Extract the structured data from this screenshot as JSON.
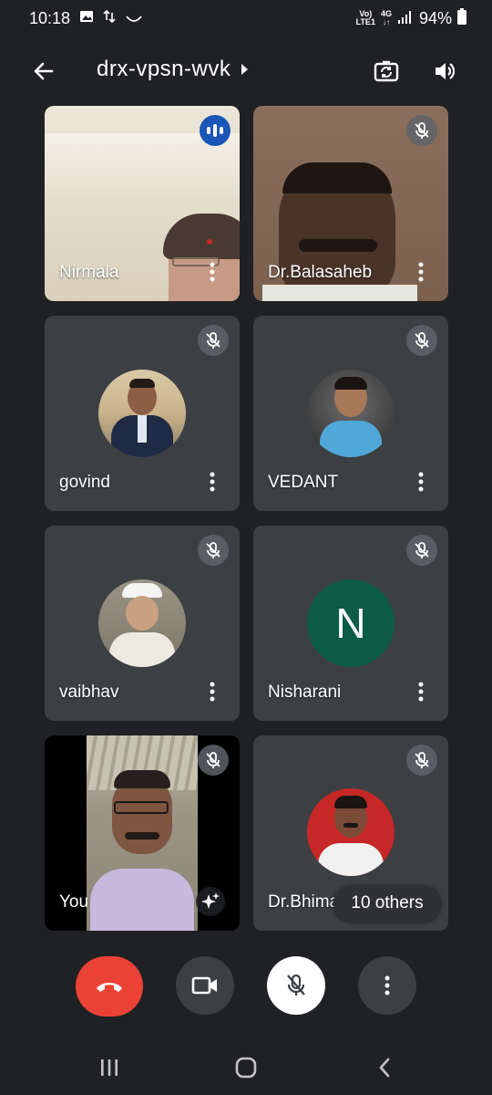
{
  "status_bar": {
    "time": "10:18",
    "network_top": "Vo)",
    "network_bottom": "LTE1",
    "net_type": "4G",
    "battery": "94%"
  },
  "header": {
    "meeting_code": "drx-vpsn-wvk",
    "icons": [
      "back-arrow-icon",
      "chevron-right-icon",
      "switch-camera-icon",
      "speaker-icon"
    ]
  },
  "participants": [
    {
      "name": "Nirmala",
      "state": "speaking",
      "media": "video"
    },
    {
      "name": "Dr.Balasaheb",
      "state": "muted",
      "media": "video"
    },
    {
      "name": "govind",
      "state": "muted",
      "media": "avatar-photo"
    },
    {
      "name": "VEDANT",
      "state": "muted",
      "media": "avatar-photo"
    },
    {
      "name": "vaibhav",
      "state": "muted",
      "media": "avatar-photo"
    },
    {
      "name": "Nisharani",
      "state": "muted",
      "media": "avatar-letter",
      "initial": "N",
      "avatar_color": "#0d5c46"
    },
    {
      "name": "You",
      "state": "muted",
      "media": "video"
    },
    {
      "name": "Dr.Bhima",
      "state": "muted",
      "media": "avatar-photo"
    }
  ],
  "others_label": "10 others",
  "controls": {
    "end_call_color": "#ea4335",
    "icons": [
      "hang-up-icon",
      "video-camera-icon",
      "mic-off-icon",
      "more-vert-icon"
    ]
  },
  "colors": {
    "background": "#202124",
    "tile": "#3c4043",
    "speaking": "#1a56b8"
  }
}
